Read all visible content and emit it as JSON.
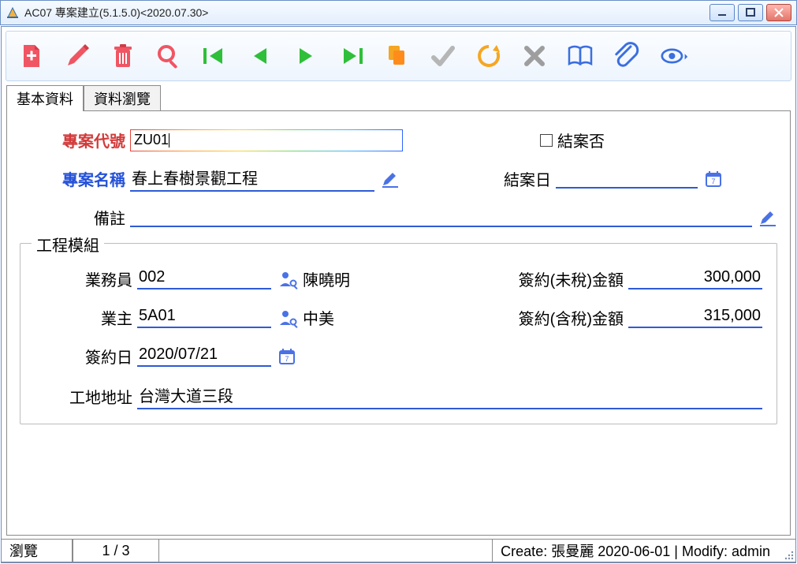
{
  "window": {
    "title": "AC07 專案建立(5.1.5.0)<2020.07.30>"
  },
  "tabs": {
    "basic": "基本資料",
    "browse": "資料瀏覽"
  },
  "labels": {
    "project_code": "專案代號",
    "closed_flag": "結案否",
    "project_name": "專案名稱",
    "close_date": "結案日",
    "remark": "備註"
  },
  "group": {
    "legend": "工程模組",
    "sales_label": "業務員",
    "owner_label": "業主",
    "contract_date_label": "簽約日",
    "site_address_label": "工地地址",
    "amount_excl_label": "簽約(未稅)金額",
    "amount_incl_label": "簽約(含稅)金額"
  },
  "values": {
    "project_code": "ZU01",
    "project_name": "春上春樹景觀工程",
    "close_date": "",
    "remark": "",
    "sales_code": "002",
    "sales_name": "陳曉明",
    "owner_code": "5A01",
    "owner_name": "中美",
    "contract_date": "2020/07/21",
    "site_address": "台灣大道三段",
    "amount_excl": "300,000",
    "amount_incl": "315,000"
  },
  "status": {
    "mode": "瀏覽",
    "page": "1 / 3",
    "info": "Create: 張曼麗 2020-06-01 | Modify: admin"
  }
}
